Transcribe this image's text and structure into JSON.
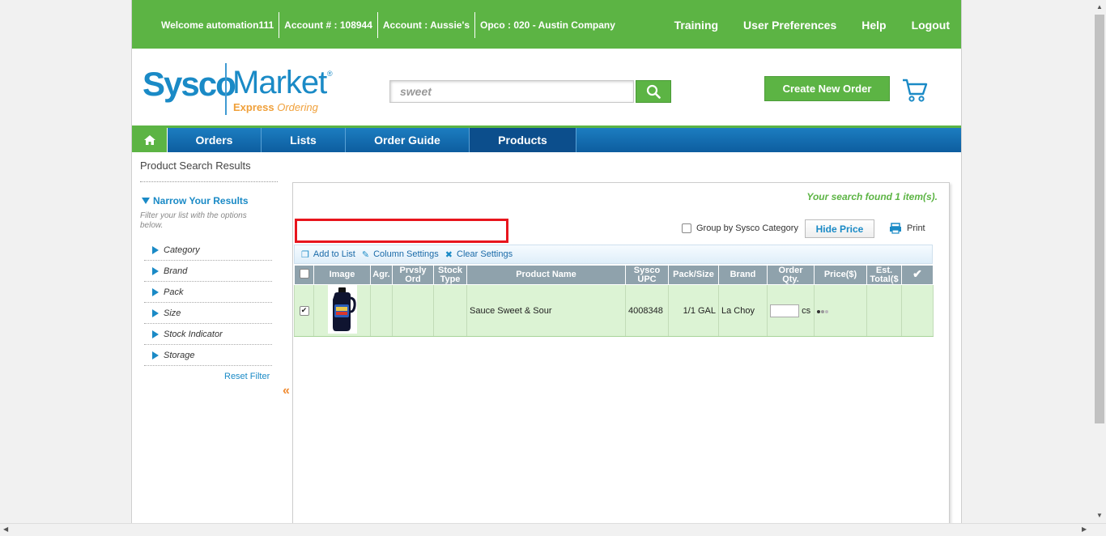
{
  "topbar": {
    "welcome": "Welcome automation111",
    "account_num": "Account # : 108944",
    "account_name": "Account : Aussie's",
    "opco": "Opco : 020 - Austin Company",
    "links": [
      "Training",
      "User Preferences",
      "Help",
      "Logout"
    ]
  },
  "logo": {
    "sysco": "Sysco",
    "market": "Market",
    "reg": "®",
    "express": "Express",
    "ordering": "Ordering"
  },
  "search": {
    "value": "sweet"
  },
  "header": {
    "create_order": "Create New Order"
  },
  "nav": {
    "items": [
      "Orders",
      "Lists",
      "Order Guide",
      "Products"
    ]
  },
  "breadcrumb": "Product Search Results",
  "filters": {
    "title": "Narrow Your Results",
    "subtitle": "Filter your list with the options below.",
    "items": [
      "Category",
      "Brand",
      "Pack",
      "Size",
      "Stock Indicator",
      "Storage"
    ],
    "reset": "Reset Filter",
    "collapse": "«"
  },
  "results": {
    "found": "Your search found 1 item(s).",
    "group_label": "Group by Sysco Category",
    "hide_price": "Hide Price",
    "print": "Print"
  },
  "toolbar": {
    "add_to_list": "Add to List",
    "column_settings": "Column Settings",
    "clear_settings": "Clear Settings"
  },
  "table": {
    "headers": {
      "image": "Image",
      "agr": "Agr.",
      "prvsly1": "Prvsly",
      "prvsly2": "Ord",
      "stock1": "Stock",
      "stock2": "Type",
      "name": "Product Name",
      "upc1": "Sysco",
      "upc2": "UPC",
      "pack": "Pack/Size",
      "brand": "Brand",
      "qty1": "Order",
      "qty2": "Qty.",
      "price": "Price($)",
      "est1": "Est.",
      "est2": "Total($"
    },
    "rows": [
      {
        "name": "Sauce Sweet & Sour",
        "upc": "4008348",
        "pack": "1/1 GAL",
        "brand": "La Choy",
        "unit": "cs"
      }
    ]
  }
}
